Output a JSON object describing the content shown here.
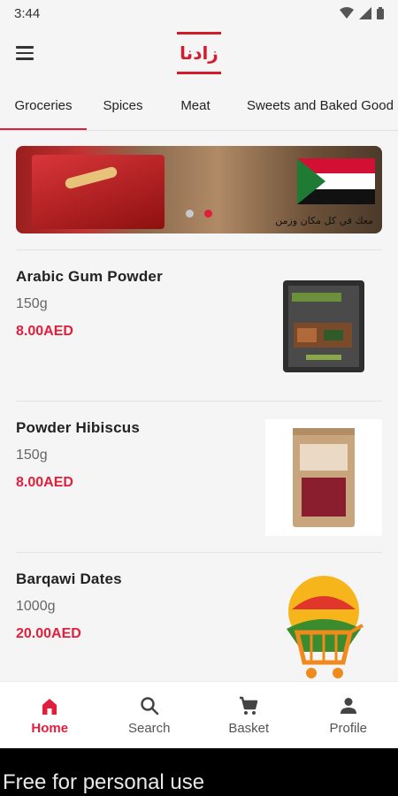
{
  "status_bar": {
    "time": "3:44"
  },
  "app": {
    "logo_text": "زادنا"
  },
  "tabs": [
    {
      "label": "Groceries",
      "active": true
    },
    {
      "label": "Spices",
      "active": false
    },
    {
      "label": "Meat",
      "active": false
    },
    {
      "label": "Sweets and Baked Good",
      "active": false
    }
  ],
  "banner": {
    "caption": "معك في كل مكان وزمن",
    "slide_count": 2,
    "active_slide": 2
  },
  "products": [
    {
      "name": "Arabic Gum Powder",
      "weight": "150g",
      "price": "8.00AED"
    },
    {
      "name": "Powder Hibiscus",
      "weight": "150g",
      "price": "8.00AED"
    },
    {
      "name": "Barqawi Dates",
      "weight": "1000g",
      "price": "20.00AED"
    }
  ],
  "bottom_nav": [
    {
      "label": "Home",
      "icon": "home-icon",
      "active": true
    },
    {
      "label": "Search",
      "icon": "search-icon",
      "active": false
    },
    {
      "label": "Basket",
      "icon": "cart-icon",
      "active": false
    },
    {
      "label": "Profile",
      "icon": "person-icon",
      "active": false
    }
  ],
  "watermark": "Free for personal use",
  "colors": {
    "accent": "#e01f3d",
    "logo_red": "#d41b2c",
    "background": "#f5f5f5"
  }
}
